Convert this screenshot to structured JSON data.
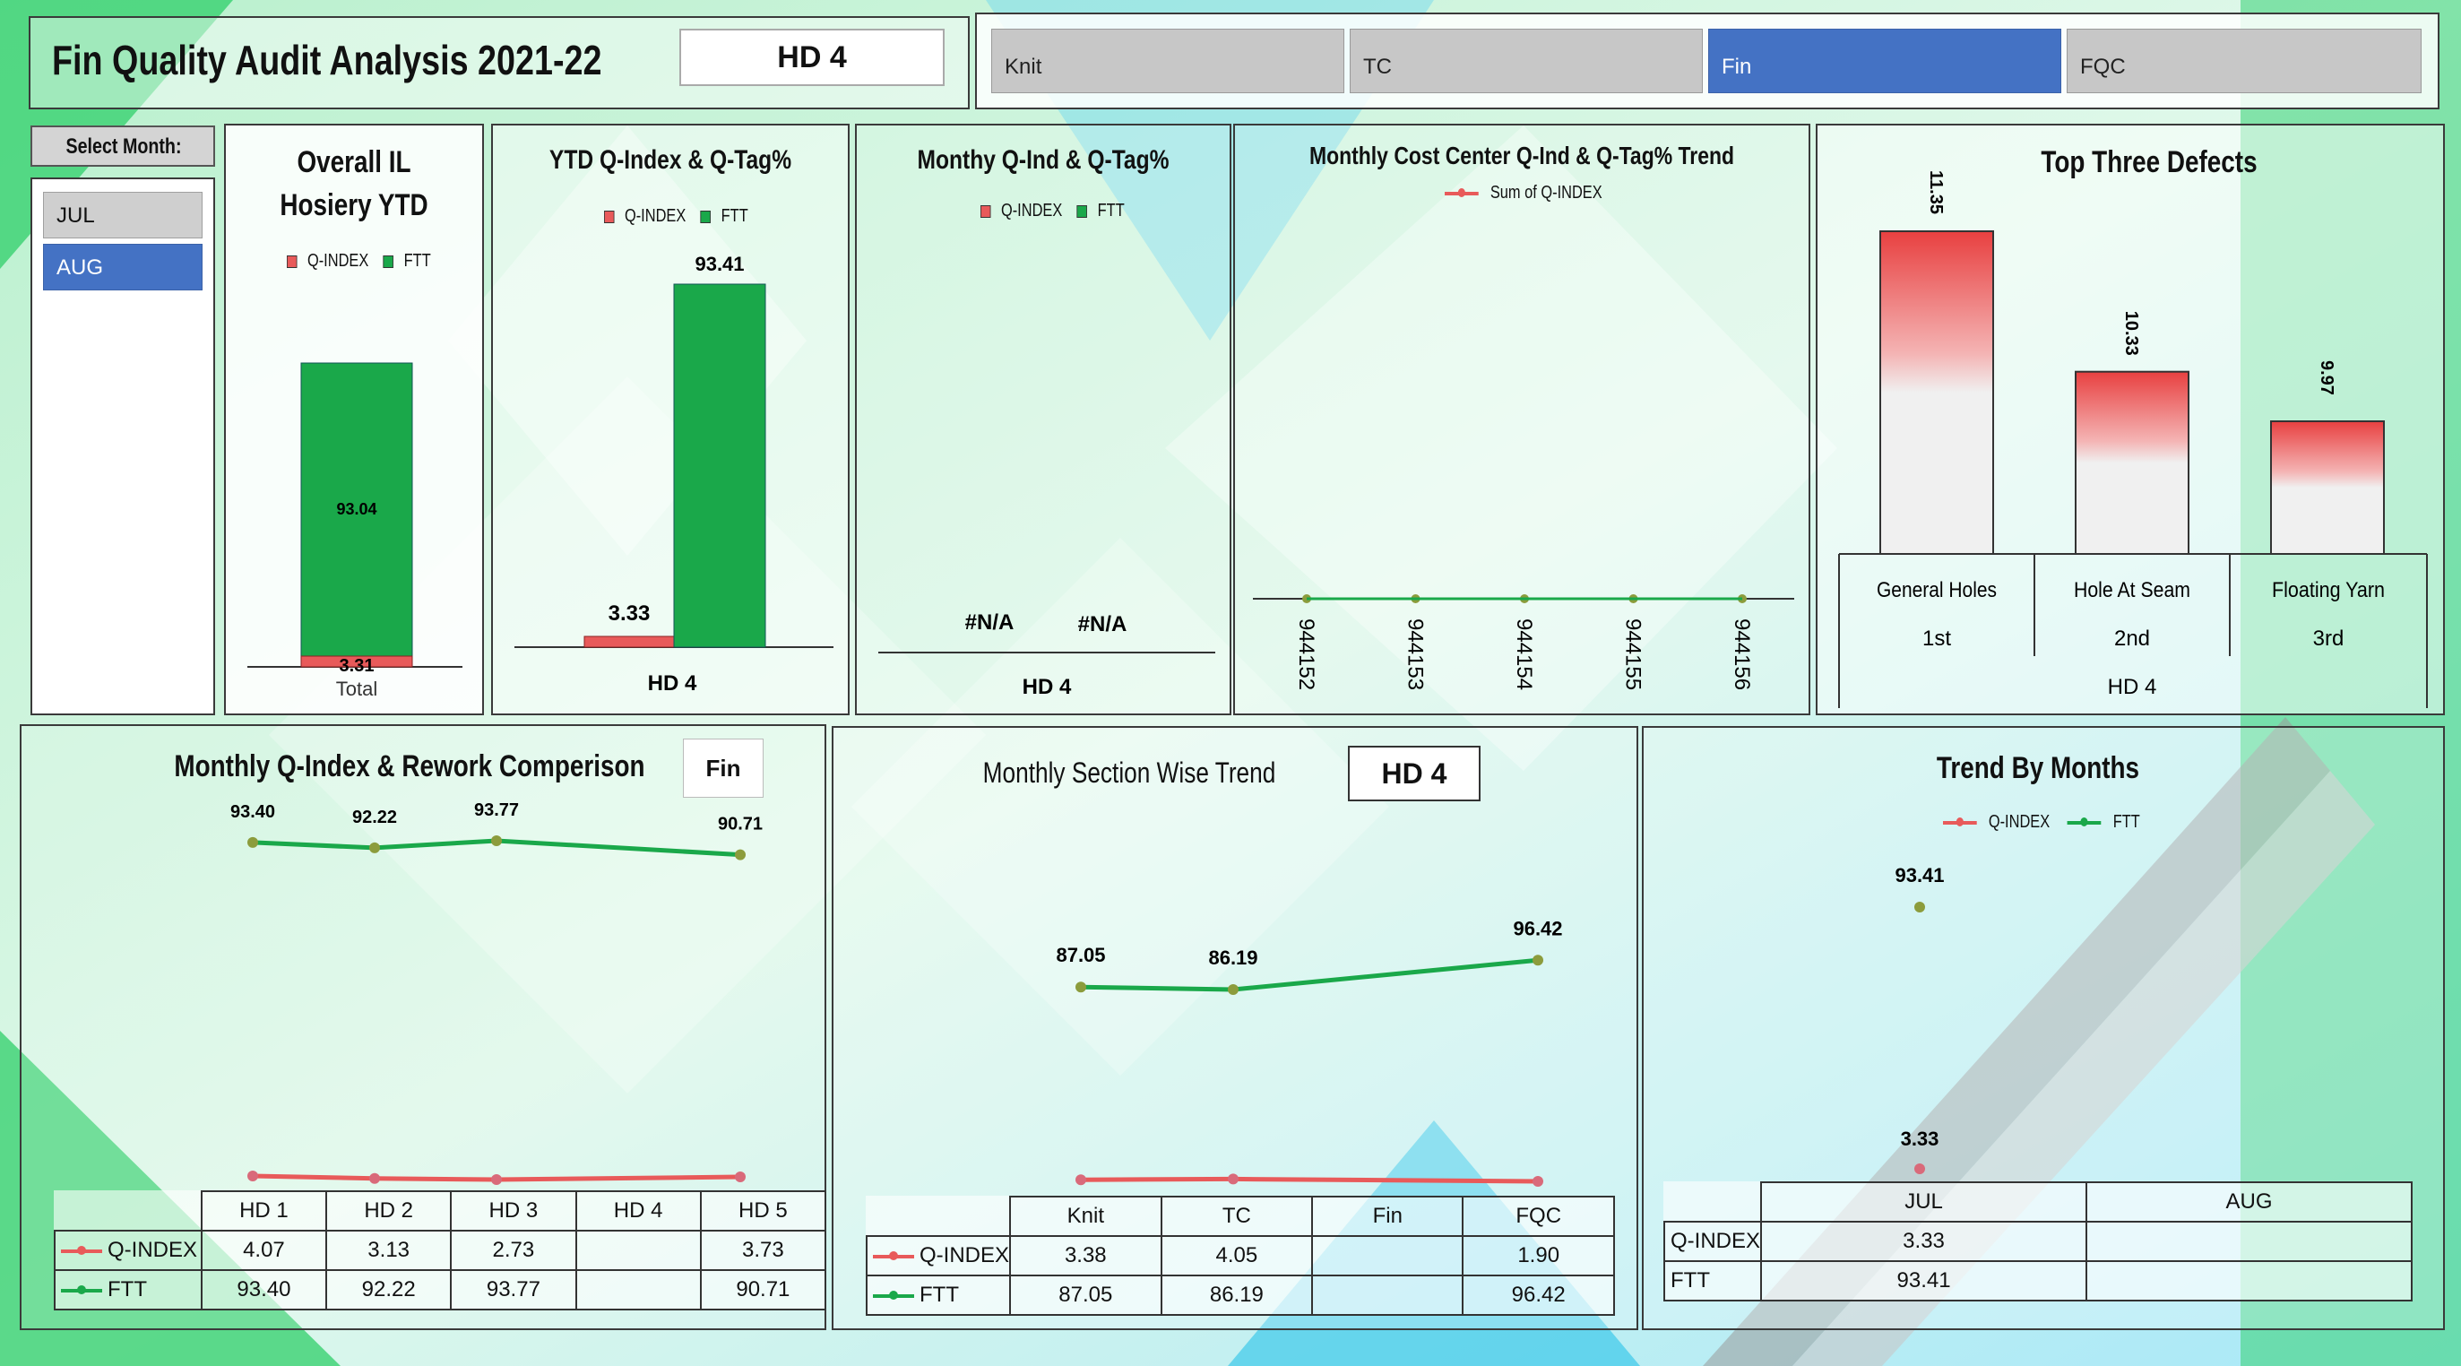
{
  "header": {
    "title": "Fin  Quality Audit Analysis 2021-22",
    "selected_dept": "HD 4",
    "tabs": [
      {
        "label": "Knit",
        "active": false
      },
      {
        "label": "TC",
        "active": false
      },
      {
        "label": "Fin",
        "active": true
      },
      {
        "label": "FQC",
        "active": false
      }
    ]
  },
  "month_slicer": {
    "label": "Select Month:",
    "items": [
      {
        "label": "JUL",
        "active": false
      },
      {
        "label": "AUG",
        "active": true
      }
    ]
  },
  "colors": {
    "q_index": "#e85a5a",
    "ftt": "#1aa84a",
    "accent": "#4472c4"
  },
  "legend": {
    "q_index": "Q-INDEX",
    "ftt": "FTT",
    "sum_q_index": "Sum of Q-INDEX"
  },
  "chart_data": [
    {
      "id": "overall",
      "type": "bar",
      "title_line1": "Overall IL",
      "title_line2": "Hosiery YTD",
      "categories": [
        "Total"
      ],
      "series": [
        {
          "name": "Q-INDEX",
          "values": [
            3.31
          ]
        },
        {
          "name": "FTT",
          "values": [
            93.04
          ]
        }
      ],
      "data_labels": [
        "3.31",
        "93.04"
      ],
      "stacked": true
    },
    {
      "id": "ytd",
      "type": "bar",
      "title": "YTD Q-Index & Q-Tag%",
      "categories": [
        "HD 4"
      ],
      "series": [
        {
          "name": "Q-INDEX",
          "values": [
            3.33
          ]
        },
        {
          "name": "FTT",
          "values": [
            93.41
          ]
        }
      ],
      "data_labels": [
        "3.33",
        "93.41"
      ]
    },
    {
      "id": "monthly",
      "type": "bar",
      "title": "Monthy Q-Ind & Q-Tag%",
      "categories": [
        "HD 4"
      ],
      "series": [
        {
          "name": "Q-INDEX",
          "values": [
            "#N/A"
          ]
        },
        {
          "name": "FTT",
          "values": [
            "#N/A"
          ]
        }
      ],
      "data_labels": [
        "#N/A",
        "#N/A"
      ]
    },
    {
      "id": "cost_center",
      "type": "line",
      "title": "Monthly Cost Center Q-Ind & Q-Tag% Trend",
      "categories": [
        "944152",
        "944153",
        "944154",
        "944155",
        "944156"
      ],
      "series": [
        {
          "name": "Sum of Q-INDEX",
          "values": [
            0,
            0,
            0,
            0,
            0
          ]
        }
      ]
    },
    {
      "id": "top_defects",
      "type": "bar",
      "title": "Top Three Defects",
      "categories": [
        "General Holes",
        "Hole At Seam",
        "Floating Yarn"
      ],
      "ranks": [
        "1st",
        "2nd",
        "3rd"
      ],
      "group": "HD 4",
      "values": [
        11.35,
        10.33,
        9.97
      ],
      "data_labels": [
        "11.35",
        "10.33",
        "9.97"
      ]
    },
    {
      "id": "rework",
      "type": "line",
      "title": "Monthly Q-Index & Rework Comperison",
      "filter": "Fin",
      "categories": [
        "HD 1",
        "HD 2",
        "HD 3",
        "HD 4",
        "HD 5"
      ],
      "series": [
        {
          "name": "Q-INDEX",
          "values": [
            4.07,
            3.13,
            2.73,
            null,
            3.73
          ]
        },
        {
          "name": "FTT",
          "values": [
            93.4,
            92.22,
            93.77,
            null,
            90.71
          ]
        }
      ],
      "table": {
        "q_index": [
          "4.07",
          "3.13",
          "2.73",
          "",
          "3.73"
        ],
        "ftt": [
          "93.40",
          "92.22",
          "93.77",
          "",
          "90.71"
        ]
      },
      "data_labels": [
        "93.40",
        "92.22",
        "93.77",
        "90.71"
      ]
    },
    {
      "id": "section",
      "type": "line",
      "title": "Monthly Section Wise Trend",
      "filter": "HD 4",
      "categories": [
        "Knit",
        "TC",
        "Fin",
        "FQC"
      ],
      "series": [
        {
          "name": "Q-INDEX",
          "values": [
            3.38,
            4.05,
            null,
            1.9
          ]
        },
        {
          "name": "FTT",
          "values": [
            87.05,
            86.19,
            null,
            96.42
          ]
        }
      ],
      "table": {
        "q_index": [
          "3.38",
          "4.05",
          "",
          "1.90"
        ],
        "ftt": [
          "87.05",
          "86.19",
          "",
          "96.42"
        ]
      },
      "data_labels": [
        "87.05",
        "86.19",
        "96.42"
      ]
    },
    {
      "id": "trend_months",
      "type": "line",
      "title": "Trend By Months",
      "categories": [
        "JUL",
        "AUG"
      ],
      "series": [
        {
          "name": "Q-INDEX",
          "values": [
            3.33,
            null
          ]
        },
        {
          "name": "FTT",
          "values": [
            93.41,
            null
          ]
        }
      ],
      "table": {
        "q_index": [
          "3.33",
          ""
        ],
        "ftt": [
          "93.41",
          ""
        ]
      },
      "data_labels": [
        "93.41",
        "3.33"
      ]
    }
  ]
}
